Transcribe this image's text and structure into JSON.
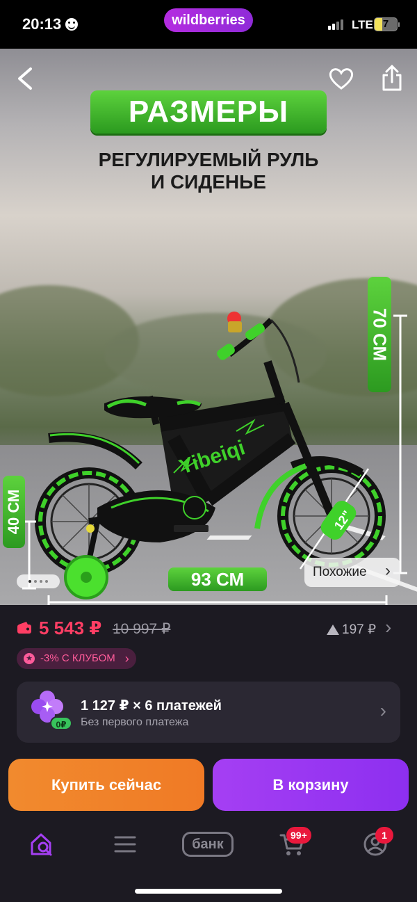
{
  "status_bar": {
    "time": "20:13",
    "network": "LTE",
    "battery": "7"
  },
  "header": {
    "brand": "wildberries"
  },
  "hero": {
    "title": "РАЗМЕРЫ",
    "subtitle_line1": "РЕГУЛИРУЕМЫЙ РУЛЬ",
    "subtitle_line2": "И СИДЕНЬЕ",
    "height_label": "70 СМ",
    "seat_label": "40 СМ",
    "length_label": "93 СМ",
    "wheel_label": "12\"",
    "bike_brand": "Yibeiqi",
    "similar_label": "Похожие",
    "gallery_position": 1
  },
  "price": {
    "current": "5 543 ₽",
    "old": "10 997 ₽",
    "drop": "197 ₽",
    "club_label": "-3% С КЛУБОМ"
  },
  "installments": {
    "title": "1 127 ₽ × 6 платежей",
    "subtitle": "Без первого платежа",
    "badge": "0₽"
  },
  "actions": {
    "buy_now": "Купить сейчас",
    "add_to_cart": "В корзину"
  },
  "nav": {
    "bank": "банк",
    "cart_badge": "99+",
    "profile_badge": "1"
  },
  "colors": {
    "accent_purple": "#a53ff3",
    "accent_orange": "#f18a2e",
    "price_red": "#ff3e64",
    "green": "#4cc234"
  }
}
